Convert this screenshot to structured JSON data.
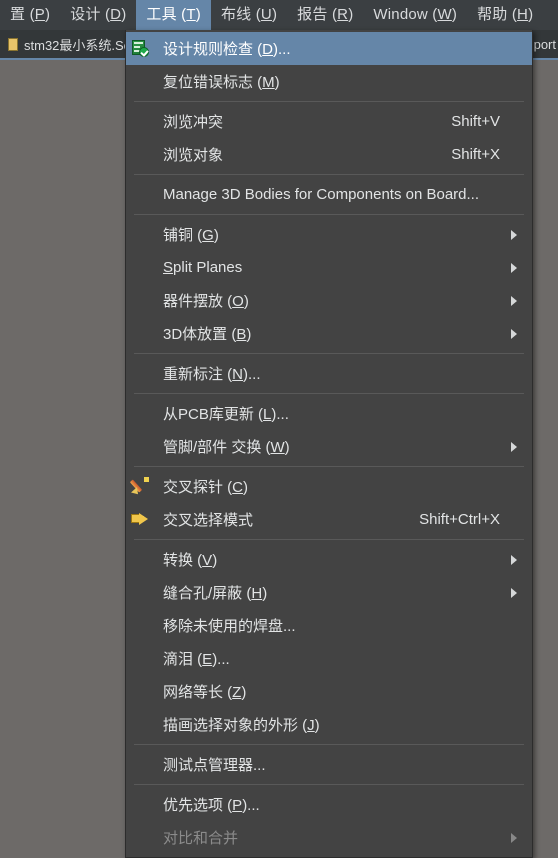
{
  "menubar": {
    "items": [
      {
        "label": "置 (P)",
        "accel": "P",
        "active": false,
        "name": "menubar-item-settings"
      },
      {
        "label": "设计 (D)",
        "accel": "D",
        "active": false,
        "name": "menubar-item-design"
      },
      {
        "label": "工具 (T)",
        "accel": "T",
        "active": true,
        "name": "menubar-item-tools"
      },
      {
        "label": "布线 (U)",
        "accel": "U",
        "active": false,
        "name": "menubar-item-route"
      },
      {
        "label": "报告 (R)",
        "accel": "R",
        "active": false,
        "name": "menubar-item-reports"
      },
      {
        "label": "Window (W)",
        "accel": "W",
        "active": false,
        "name": "menubar-item-window"
      },
      {
        "label": "帮助 (H)",
        "accel": "H",
        "active": false,
        "name": "menubar-item-help"
      }
    ]
  },
  "tabstrip": {
    "document_tab_label": "stm32最小系统.Sc",
    "right_partial_label": "port"
  },
  "tools_menu": {
    "items": [
      {
        "kind": "item",
        "label": "设计规则检查 (D)...",
        "accel": "D",
        "shortcut": "",
        "icon": "drc-check-icon",
        "arrow": false,
        "highlight": true,
        "disabled": false,
        "name": "menu-item-design-rule-check"
      },
      {
        "kind": "item",
        "label": "复位错误标志 (M)",
        "accel": "M",
        "shortcut": "",
        "icon": "",
        "arrow": false,
        "highlight": false,
        "disabled": false,
        "name": "menu-item-reset-error-markers"
      },
      {
        "kind": "separator",
        "name": "menu-separator-1"
      },
      {
        "kind": "item",
        "label": "浏览冲突",
        "accel": "",
        "shortcut": "Shift+V",
        "icon": "",
        "arrow": false,
        "highlight": false,
        "disabled": false,
        "name": "menu-item-browse-violations"
      },
      {
        "kind": "item",
        "label": "浏览对象",
        "accel": "",
        "shortcut": "Shift+X",
        "icon": "",
        "arrow": false,
        "highlight": false,
        "disabled": false,
        "name": "menu-item-browse-objects"
      },
      {
        "kind": "separator",
        "name": "menu-separator-2"
      },
      {
        "kind": "item",
        "label": "Manage 3D Bodies for Components on Board...",
        "accel": "",
        "shortcut": "",
        "icon": "",
        "arrow": false,
        "highlight": false,
        "disabled": false,
        "name": "menu-item-manage-3d-bodies"
      },
      {
        "kind": "separator",
        "name": "menu-separator-3"
      },
      {
        "kind": "item",
        "label": "铺铜 (G)",
        "accel": "G",
        "shortcut": "",
        "icon": "",
        "arrow": true,
        "highlight": false,
        "disabled": false,
        "name": "menu-item-polygon-pours"
      },
      {
        "kind": "item",
        "label": "Split Planes",
        "accel": "S",
        "shortcut": "",
        "icon": "",
        "arrow": true,
        "highlight": false,
        "disabled": false,
        "name": "menu-item-split-planes"
      },
      {
        "kind": "item",
        "label": "器件摆放 (O)",
        "accel": "O",
        "shortcut": "",
        "icon": "",
        "arrow": true,
        "highlight": false,
        "disabled": false,
        "name": "menu-item-component-placement"
      },
      {
        "kind": "item",
        "label": "3D体放置 (B)",
        "accel": "B",
        "shortcut": "",
        "icon": "",
        "arrow": true,
        "highlight": false,
        "disabled": false,
        "name": "menu-item-3d-body-placement"
      },
      {
        "kind": "separator",
        "name": "menu-separator-4"
      },
      {
        "kind": "item",
        "label": "重新标注 (N)...",
        "accel": "N",
        "shortcut": "",
        "icon": "",
        "arrow": false,
        "highlight": false,
        "disabled": false,
        "name": "menu-item-re-annotate"
      },
      {
        "kind": "separator",
        "name": "menu-separator-5"
      },
      {
        "kind": "item",
        "label": "从PCB库更新 (L)...",
        "accel": "L",
        "shortcut": "",
        "icon": "",
        "arrow": false,
        "highlight": false,
        "disabled": false,
        "name": "menu-item-update-from-pcb-library"
      },
      {
        "kind": "item",
        "label": "管脚/部件 交换 (W)",
        "accel": "W",
        "shortcut": "",
        "icon": "",
        "arrow": true,
        "highlight": false,
        "disabled": false,
        "name": "menu-item-pin-part-swap"
      },
      {
        "kind": "separator",
        "name": "menu-separator-6"
      },
      {
        "kind": "item",
        "label": "交叉探针 (C)",
        "accel": "C",
        "shortcut": "",
        "icon": "cross-probe-icon",
        "arrow": false,
        "highlight": false,
        "disabled": false,
        "name": "menu-item-cross-probe"
      },
      {
        "kind": "item",
        "label": "交叉选择模式",
        "accel": "",
        "shortcut": "Shift+Ctrl+X",
        "icon": "cross-select-mode-icon",
        "arrow": false,
        "highlight": false,
        "disabled": false,
        "name": "menu-item-cross-select-mode"
      },
      {
        "kind": "separator",
        "name": "menu-separator-7"
      },
      {
        "kind": "item",
        "label": "转换 (V)",
        "accel": "V",
        "shortcut": "",
        "icon": "",
        "arrow": true,
        "highlight": false,
        "disabled": false,
        "name": "menu-item-convert"
      },
      {
        "kind": "item",
        "label": "缝合孔/屏蔽 (H)",
        "accel": "H",
        "shortcut": "",
        "icon": "",
        "arrow": true,
        "highlight": false,
        "disabled": false,
        "name": "menu-item-via-stitching-shielding"
      },
      {
        "kind": "item",
        "label": "移除未使用的焊盘...",
        "accel": "",
        "shortcut": "",
        "icon": "",
        "arrow": false,
        "highlight": false,
        "disabled": false,
        "name": "menu-item-remove-unused-pad-shapes"
      },
      {
        "kind": "item",
        "label": "滴泪 (E)...",
        "accel": "E",
        "shortcut": "",
        "icon": "",
        "arrow": false,
        "highlight": false,
        "disabled": false,
        "name": "menu-item-teardrops"
      },
      {
        "kind": "item",
        "label": "网络等长 (Z)",
        "accel": "Z",
        "shortcut": "",
        "icon": "",
        "arrow": false,
        "highlight": false,
        "disabled": false,
        "name": "menu-item-equalize-net-lengths"
      },
      {
        "kind": "item",
        "label": "描画选择对象的外形 (J)",
        "accel": "J",
        "shortcut": "",
        "icon": "",
        "arrow": false,
        "highlight": false,
        "disabled": false,
        "name": "menu-item-outline-selected-objects"
      },
      {
        "kind": "separator",
        "name": "menu-separator-8"
      },
      {
        "kind": "item",
        "label": "测试点管理器...",
        "accel": "",
        "shortcut": "",
        "icon": "",
        "arrow": false,
        "highlight": false,
        "disabled": false,
        "name": "menu-item-testpoint-manager"
      },
      {
        "kind": "separator",
        "name": "menu-separator-9"
      },
      {
        "kind": "item",
        "label": "优先选项 (P)...",
        "accel": "P",
        "shortcut": "",
        "icon": "",
        "arrow": false,
        "highlight": false,
        "disabled": false,
        "name": "menu-item-preferences"
      },
      {
        "kind": "item",
        "label": "对比和合并",
        "accel": "",
        "shortcut": "",
        "icon": "",
        "arrow": true,
        "highlight": false,
        "disabled": true,
        "name": "menu-item-compare-and-merge"
      }
    ]
  },
  "colors": {
    "menu_bg": "#434343",
    "menubar_bg": "#3b3f42",
    "highlight": "#6586a8",
    "canvas_bg": "#6d6a68",
    "text": "#e2e4e5",
    "text_disabled": "#8b8b8b",
    "separator": "#595959",
    "tabstrip_bg": "#333739"
  }
}
